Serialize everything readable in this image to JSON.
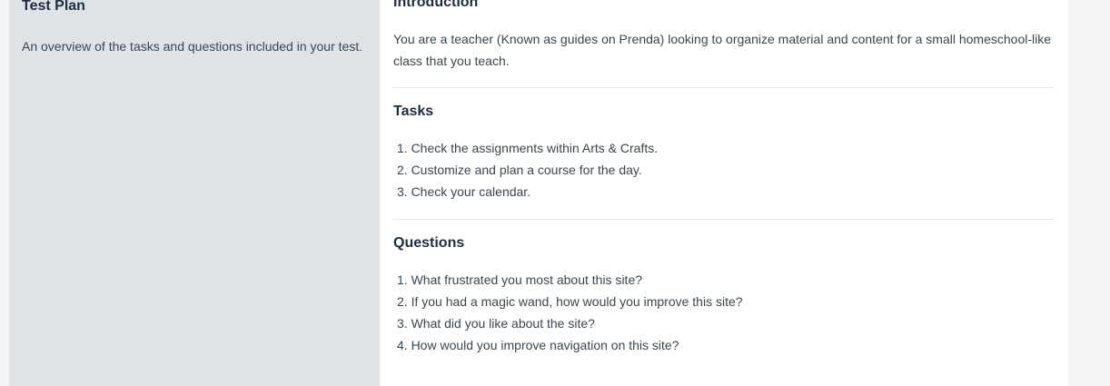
{
  "sidebar": {
    "title": "Test Plan",
    "description": "An overview of the tasks and questions included in your test."
  },
  "introduction": {
    "title": "Introduction",
    "text": "You are a teacher (Known as guides on Prenda) looking to organize material and content for a small homeschool-like class that you teach."
  },
  "tasks": {
    "title": "Tasks",
    "items": [
      "1. Check the assignments within Arts & Crafts.",
      "2. Customize and plan a course for the day.",
      "3. Check your calendar."
    ]
  },
  "questions": {
    "title": "Questions",
    "items": [
      "1. What frustrated you most about this site?",
      "2. If you had a magic wand, how would you improve this site?",
      "3. What did you like about the site?",
      "4. How would you improve navigation on this site?"
    ]
  },
  "colors": {
    "sidebar_bg": "#dee3e8",
    "main_bg": "#ffffff",
    "page_bg": "#f2f4f6",
    "heading": "#1f2d3d",
    "body_text": "#3a4652",
    "divider": "#e4e8ec"
  }
}
